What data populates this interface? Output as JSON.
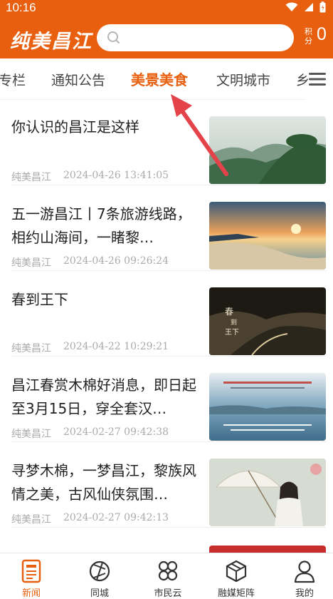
{
  "status_bar": {
    "time": "10:16"
  },
  "header": {
    "logo_text": "纯美昌江",
    "search_placeholder": "",
    "points_label": "积分",
    "points_value": "0"
  },
  "tabs": [
    {
      "label": "专栏",
      "active": false
    },
    {
      "label": "通知公告",
      "active": false
    },
    {
      "label": "美景美食",
      "active": true
    },
    {
      "label": "文明城市",
      "active": false
    },
    {
      "label": "乡",
      "active": false
    }
  ],
  "news": [
    {
      "title": "你认识的昌江是这样",
      "source": "纯美昌江",
      "time": "2024-04-26 13:41:05",
      "thumb": "mountain-landscape"
    },
    {
      "title": "五一游昌江丨7条旅游线路，相约山海间，一睹黎…",
      "source": "纯美昌江",
      "time": "2024-04-26 09:26:24",
      "thumb": "coast-sunset"
    },
    {
      "title": "春到王下",
      "source": "纯美昌江",
      "time": "2024-04-22 10:29:21",
      "thumb": "valley-poster"
    },
    {
      "title": "昌江春赏木棉好消息，即日起至3月15日，穿全套汉…",
      "source": "纯美昌江",
      "time": "2024-02-27 09:42:38",
      "thumb": "lake-poster"
    },
    {
      "title": "寻梦木棉，一梦昌江，黎族风情之美，古风仙侠氛围…",
      "source": "纯美昌江",
      "time": "2024-02-27 09:42:13",
      "thumb": "umbrella-girl"
    }
  ],
  "bottom_nav": [
    {
      "label": "新闻",
      "active": true,
      "icon": "news-icon"
    },
    {
      "label": "同城",
      "active": false,
      "icon": "citycircle-icon"
    },
    {
      "label": "市民云",
      "active": false,
      "icon": "cloud-grid-icon"
    },
    {
      "label": "融媒矩阵",
      "active": false,
      "icon": "cube-icon"
    },
    {
      "label": "我的",
      "active": false,
      "icon": "user-icon"
    }
  ],
  "colors": {
    "brand": "#e8600f",
    "arrow": "#e5434a"
  }
}
